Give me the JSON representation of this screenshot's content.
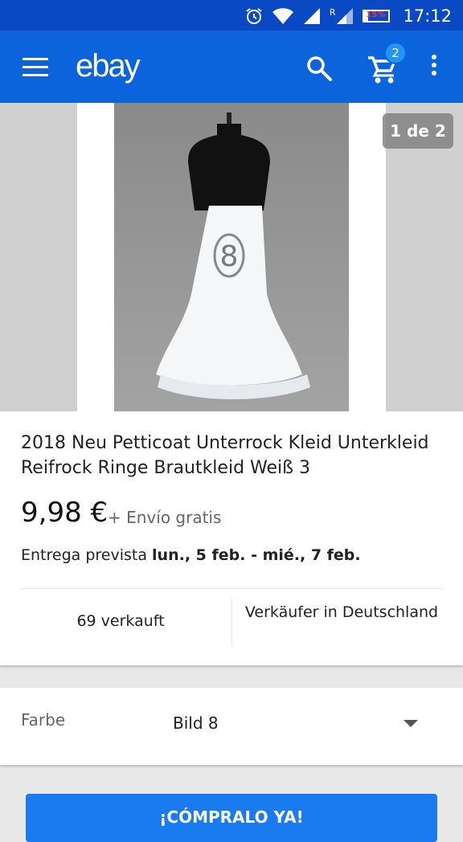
{
  "status_bar": {
    "time": "17:12",
    "battery_percent": 15,
    "battery_label": "15%",
    "network_label": "R",
    "icons": [
      "alarm-icon",
      "wifi-icon",
      "signal-icon",
      "signal-roaming-icon",
      "battery-icon"
    ]
  },
  "app_bar": {
    "logo": "ebay",
    "cart_count": "2",
    "icons": [
      "menu-icon",
      "search-icon",
      "cart-icon",
      "more-vert-icon"
    ]
  },
  "gallery": {
    "counter": "1 de 2",
    "badge_number": "8"
  },
  "product": {
    "title": "2018 Neu Petticoat Unterrock Kleid Unterkleid Reifrock Ringe Brautkleid Weiß 3",
    "price": "9,98 €",
    "shipping": "+ Envío gratis",
    "delivery_prefix": "Entrega prevista ",
    "delivery_dates": "lun., 5 feb. - mié., 7 feb.",
    "sold": "69 verkauft",
    "seller_location": "Verkäufer in Deutschland"
  },
  "variation": {
    "label": "Farbe",
    "value": "Bild 8"
  },
  "buy_button": "¡CÓMPRALO YA!",
  "colors": {
    "status_bar": "#0a49c4",
    "app_bar": "#0b64dc",
    "badge": "#2196f3",
    "buy_button": "#1a7bf0"
  }
}
